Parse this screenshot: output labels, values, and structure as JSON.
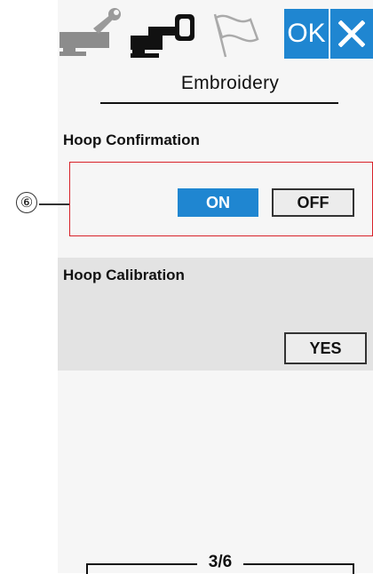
{
  "toolbar": {
    "tabs": [
      {
        "name": "settings-tab",
        "icon": "wrench-icon"
      },
      {
        "name": "embroidery-tab",
        "icon": "embroidery-machine-icon"
      },
      {
        "name": "flag-tab",
        "icon": "flag-icon"
      }
    ],
    "ok_label": "OK",
    "close_icon": "close-icon",
    "accent_color": "#1f86d1"
  },
  "page": {
    "title": "Embroidery",
    "indicator": "3/6"
  },
  "hoop_confirmation": {
    "label": "Hoop Confirmation",
    "on_label": "ON",
    "off_label": "OFF",
    "selected": "ON"
  },
  "hoop_calibration": {
    "label": "Hoop Calibration",
    "yes_label": "YES"
  },
  "callout": {
    "number": "⑥",
    "color": "#d8222a"
  }
}
